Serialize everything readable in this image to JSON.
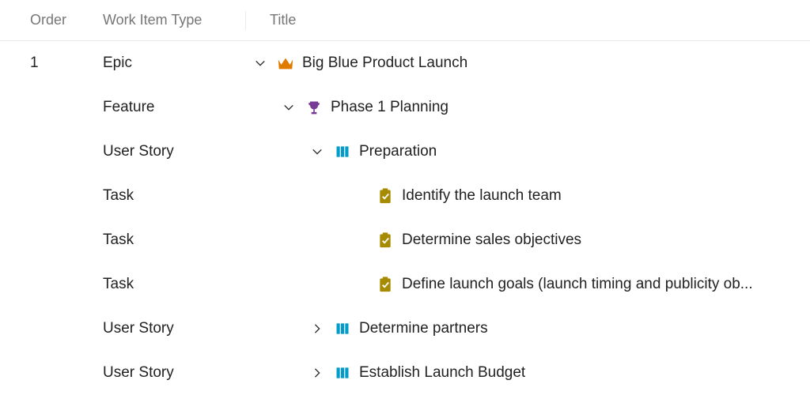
{
  "columns": {
    "order": "Order",
    "workItemType": "Work Item Type",
    "title": "Title"
  },
  "rows": [
    {
      "order": "1",
      "type": "Epic",
      "title": "Big Blue Product Launch",
      "indent": 0,
      "icon": "crown",
      "iconColor": "#e07b00",
      "expanded": true,
      "hasChildren": true
    },
    {
      "order": "",
      "type": "Feature",
      "title": "Phase 1 Planning",
      "indent": 1,
      "icon": "trophy",
      "iconColor": "#773b93",
      "expanded": true,
      "hasChildren": true
    },
    {
      "order": "",
      "type": "User Story",
      "title": "Preparation",
      "indent": 2,
      "icon": "book",
      "iconColor": "#009ccc",
      "expanded": true,
      "hasChildren": true
    },
    {
      "order": "",
      "type": "Task",
      "title": "Identify the launch team",
      "indent": 3,
      "icon": "clipboard",
      "iconColor": "#a68a00",
      "expanded": false,
      "hasChildren": false
    },
    {
      "order": "",
      "type": "Task",
      "title": "Determine sales objectives",
      "indent": 3,
      "icon": "clipboard",
      "iconColor": "#a68a00",
      "expanded": false,
      "hasChildren": false
    },
    {
      "order": "",
      "type": "Task",
      "title": "Define launch goals (launch timing and publicity ob...",
      "indent": 3,
      "icon": "clipboard",
      "iconColor": "#a68a00",
      "expanded": false,
      "hasChildren": false
    },
    {
      "order": "",
      "type": "User Story",
      "title": "Determine partners",
      "indent": 2,
      "icon": "book",
      "iconColor": "#009ccc",
      "expanded": false,
      "hasChildren": true
    },
    {
      "order": "",
      "type": "User Story",
      "title": "Establish Launch Budget",
      "indent": 2,
      "icon": "book",
      "iconColor": "#009ccc",
      "expanded": false,
      "hasChildren": true
    }
  ]
}
